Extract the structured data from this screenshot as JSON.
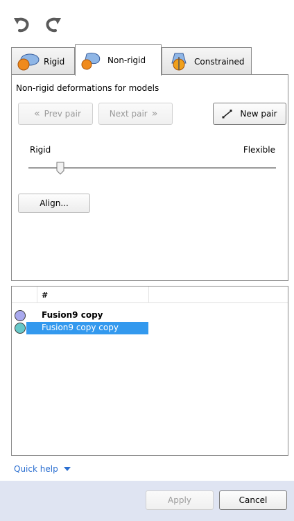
{
  "toolbar": {
    "undo_icon": "undo-icon",
    "redo_icon": "redo-icon"
  },
  "tabs": [
    {
      "label": "Rigid",
      "icon": "rigid-tab-icon",
      "active": false
    },
    {
      "label": "Non-rigid",
      "icon": "non-rigid-tab-icon",
      "active": true
    },
    {
      "label": "Constrained",
      "icon": "constrained-tab-icon",
      "active": false
    }
  ],
  "panel": {
    "title": "Non-rigid deformations for models",
    "prev_pair": "Prev pair",
    "next_pair": "Next pair",
    "new_pair": "New pair",
    "slider": {
      "left_label": "Rigid",
      "right_label": "Flexible",
      "value_fraction": 0.13
    },
    "align_button": "Align..."
  },
  "list": {
    "header_hash": "#",
    "rows": [
      {
        "name": "Fusion9 copy",
        "dot_color": "#a9a9ee",
        "bold": true,
        "selected": false
      },
      {
        "name": "Fusion9 copy copy",
        "dot_color": "#66c8c8",
        "bold": false,
        "selected": true
      }
    ]
  },
  "quick_help": {
    "label": "Quick help"
  },
  "footer": {
    "apply": "Apply",
    "cancel": "Cancel"
  },
  "colors": {
    "accent": "#3399ee",
    "footer_bg": "#dfe4f2",
    "link": "#2a6ed0"
  }
}
